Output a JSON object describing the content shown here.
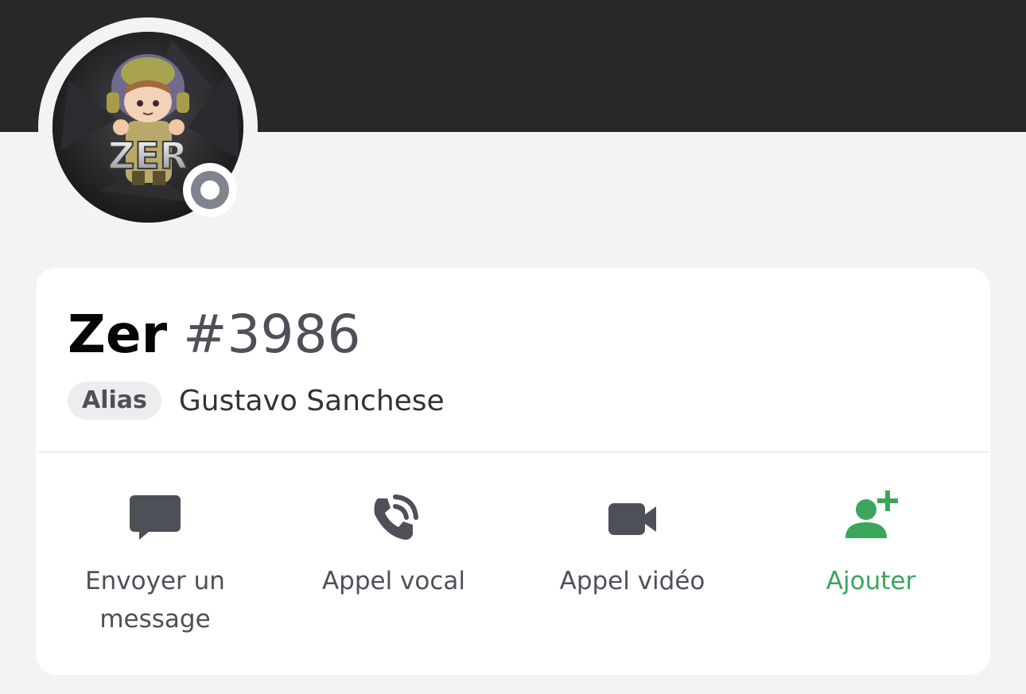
{
  "profile": {
    "username": "Zer",
    "discriminator": "#3986",
    "alias_label": "Alias",
    "alias_value": "Gustavo Sanchese",
    "status": "offline",
    "avatar_text": "ZER"
  },
  "actions": [
    {
      "label": "Envoyer un message",
      "icon": "message-icon"
    },
    {
      "label": "Appel vocal",
      "icon": "phone-call-icon"
    },
    {
      "label": "Appel vidéo",
      "icon": "video-camera-icon"
    },
    {
      "label": "Ajouter",
      "icon": "add-friend-icon"
    }
  ],
  "colors": {
    "banner": "#282828",
    "background": "#f2f3f5",
    "card": "#ffffff",
    "icon": "#4e5058",
    "accent_green": "#3ba55c",
    "status_offline": "#80848e"
  }
}
